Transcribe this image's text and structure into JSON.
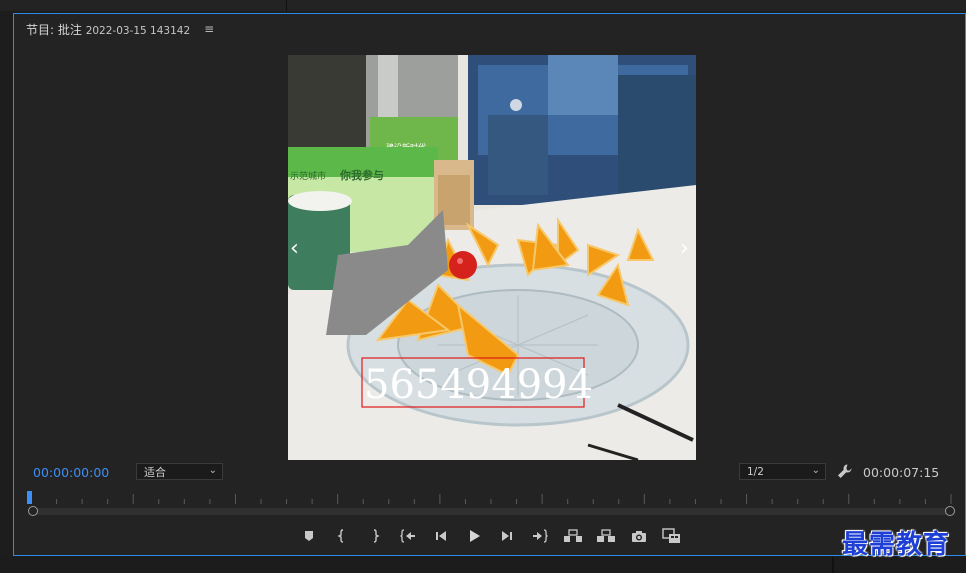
{
  "panel": {
    "title_prefix": "节目: 批注",
    "title_date": "2022-03-15 143142",
    "menu_icon": "hamburger-menu-icon"
  },
  "video": {
    "description_icon": "orange-plate-photo",
    "annotation_text": "565494994",
    "cup_text": "你我参与",
    "cup_text_small": "示范城市",
    "can_text": "建设新时代"
  },
  "controls": {
    "current_timecode": "00:00:00:00",
    "fit_label": "适合",
    "resolution_label": "1/2",
    "duration_timecode": "00:00:07:15",
    "settings_icon": "wrench-icon"
  },
  "transport": {
    "buttons": [
      {
        "name": "add-marker-button",
        "icon": "marker-icon"
      },
      {
        "name": "mark-in-button",
        "icon": "mark-in-icon"
      },
      {
        "name": "mark-out-button",
        "icon": "mark-out-icon"
      },
      {
        "name": "go-to-in-button",
        "icon": "go-to-in-icon"
      },
      {
        "name": "step-back-button",
        "icon": "step-back-icon"
      },
      {
        "name": "play-button",
        "icon": "play-icon"
      },
      {
        "name": "step-forward-button",
        "icon": "step-forward-icon"
      },
      {
        "name": "go-to-out-button",
        "icon": "go-to-out-icon"
      },
      {
        "name": "lift-button",
        "icon": "lift-icon"
      },
      {
        "name": "extract-button",
        "icon": "extract-icon"
      },
      {
        "name": "export-frame-button",
        "icon": "camera-icon"
      },
      {
        "name": "compare-view-button",
        "icon": "compare-icon"
      }
    ]
  },
  "watermark": {
    "text": "最需教育"
  },
  "colors": {
    "accent": "#2d8ceb",
    "timecode_blue": "#3d8ef5",
    "watermark": "#1d3fd6"
  }
}
